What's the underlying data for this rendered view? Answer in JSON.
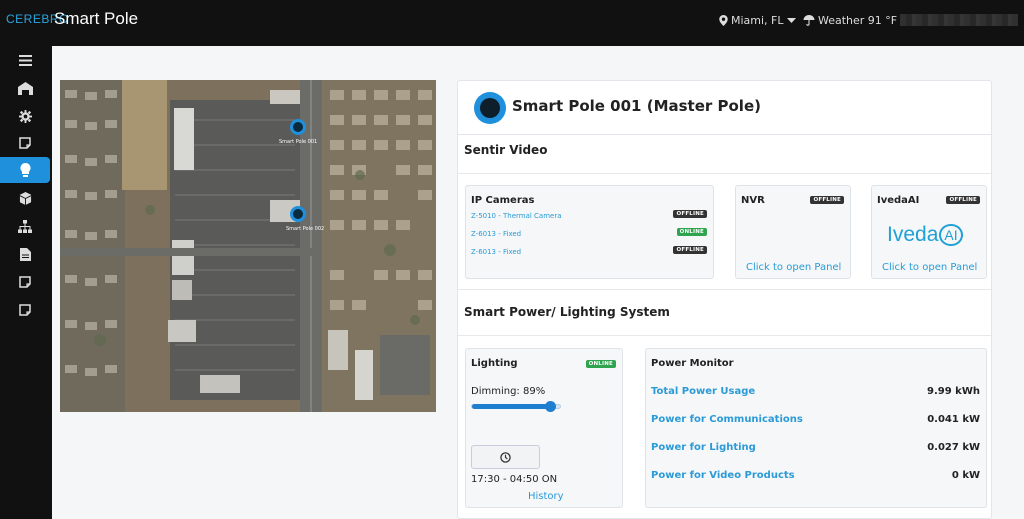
{
  "topbar": {
    "logo_text": "CEREBRO",
    "app_title": "Smart Pole",
    "location": "Miami, FL",
    "weather": "Weather 91 °F"
  },
  "sidebar": {
    "items": [
      {
        "icon": "menu-icon"
      },
      {
        "icon": "dashboard-icon"
      },
      {
        "icon": "gear-icon"
      },
      {
        "icon": "note-icon"
      },
      {
        "icon": "lightbulb-icon",
        "active": true
      },
      {
        "icon": "cube-icon"
      },
      {
        "icon": "network-icon"
      },
      {
        "icon": "document-icon"
      },
      {
        "icon": "note-icon"
      },
      {
        "icon": "note-icon"
      }
    ]
  },
  "map": {
    "pins": [
      {
        "label": "Smart Pole 001"
      },
      {
        "label": "Smart Pole 002"
      }
    ]
  },
  "panel": {
    "title": "Smart Pole 001 (Master Pole)",
    "video_section": "Sentir Video",
    "ip_cameras": {
      "title": "IP Cameras",
      "cameras": [
        {
          "name": "Z-5010 - Thermal Camera",
          "status": "OFFLINE"
        },
        {
          "name": "Z-6013 - Fixed",
          "status": "ONLINE"
        },
        {
          "name": "Z-6013 - Fixed",
          "status": "OFFLINE"
        }
      ]
    },
    "nvr": {
      "title": "NVR",
      "status": "OFFLINE",
      "link": "Click to open Panel"
    },
    "ivedaai": {
      "title": "IvedaAI",
      "status": "OFFLINE",
      "logo_text": "Iveda",
      "logo_ai": "AI",
      "link": "Click to open Panel"
    },
    "power_section": "Smart Power/ Lighting System",
    "lighting": {
      "title": "Lighting",
      "status": "ONLINE",
      "dimming_label": "Dimming: 89%",
      "dimming_value": 0.89,
      "schedule": "17:30 - 04:50 ON",
      "history_link": "History"
    },
    "power_monitor": {
      "title": "Power Monitor",
      "rows": [
        {
          "label": "Total Power Usage",
          "value": "9.99 kWh"
        },
        {
          "label": "Power for Communications",
          "value": "0.041 kW"
        },
        {
          "label": "Power for Lighting",
          "value": "0.027 kW"
        },
        {
          "label": "Power for Video Products",
          "value": "0 kW"
        }
      ]
    }
  },
  "colors": {
    "accent": "#1e90dc",
    "link": "#2a9bd8",
    "online": "#2ea44f",
    "offline": "#333333"
  }
}
